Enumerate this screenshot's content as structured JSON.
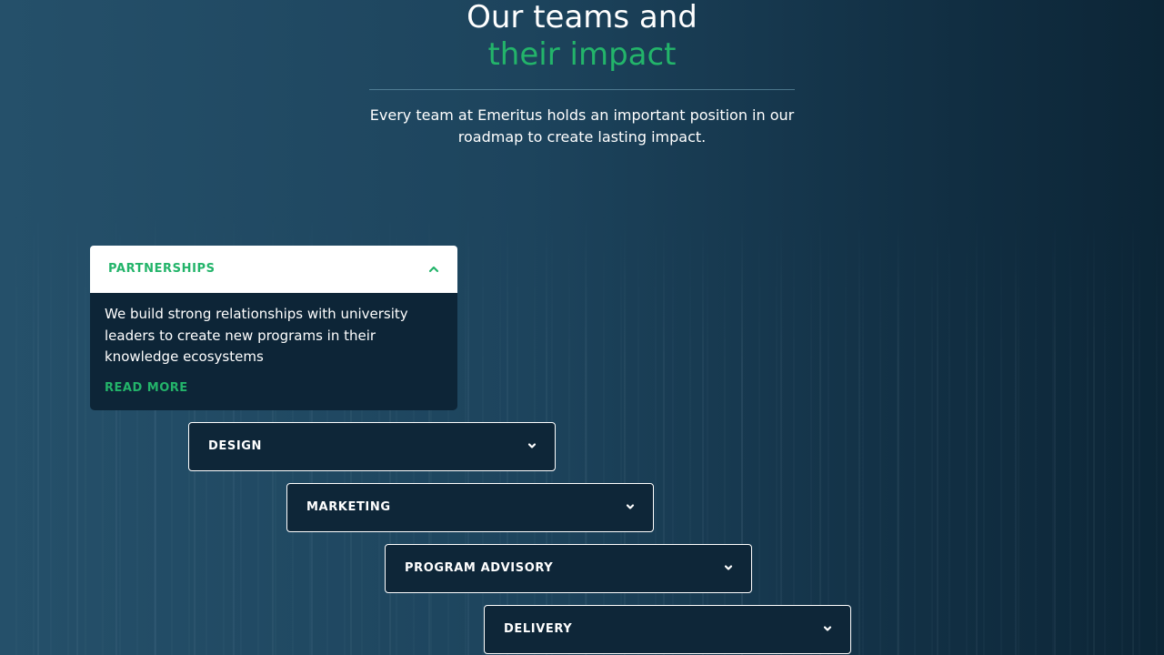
{
  "heading": {
    "line1": "Our teams and",
    "line2": "their impact"
  },
  "intro": "Every team at Emeritus holds an important position in our roadmap to create lasting impact.",
  "colors": {
    "accent": "#23b46a",
    "panel": "#0e2638",
    "text": "#ffffff"
  },
  "accordion": {
    "open": {
      "label": "PARTNERSHIPS",
      "icon": "chevron-up-icon",
      "body": "We build strong relationships with university leaders to create new programs in their knowledge ecosystems",
      "link": "READ MORE"
    },
    "items": [
      {
        "label": "DESIGN",
        "icon": "chevron-down-icon"
      },
      {
        "label": "MARKETING",
        "icon": "chevron-down-icon"
      },
      {
        "label": "PROGRAM ADVISORY",
        "icon": "chevron-down-icon"
      },
      {
        "label": "DELIVERY",
        "icon": "chevron-down-icon"
      }
    ]
  }
}
